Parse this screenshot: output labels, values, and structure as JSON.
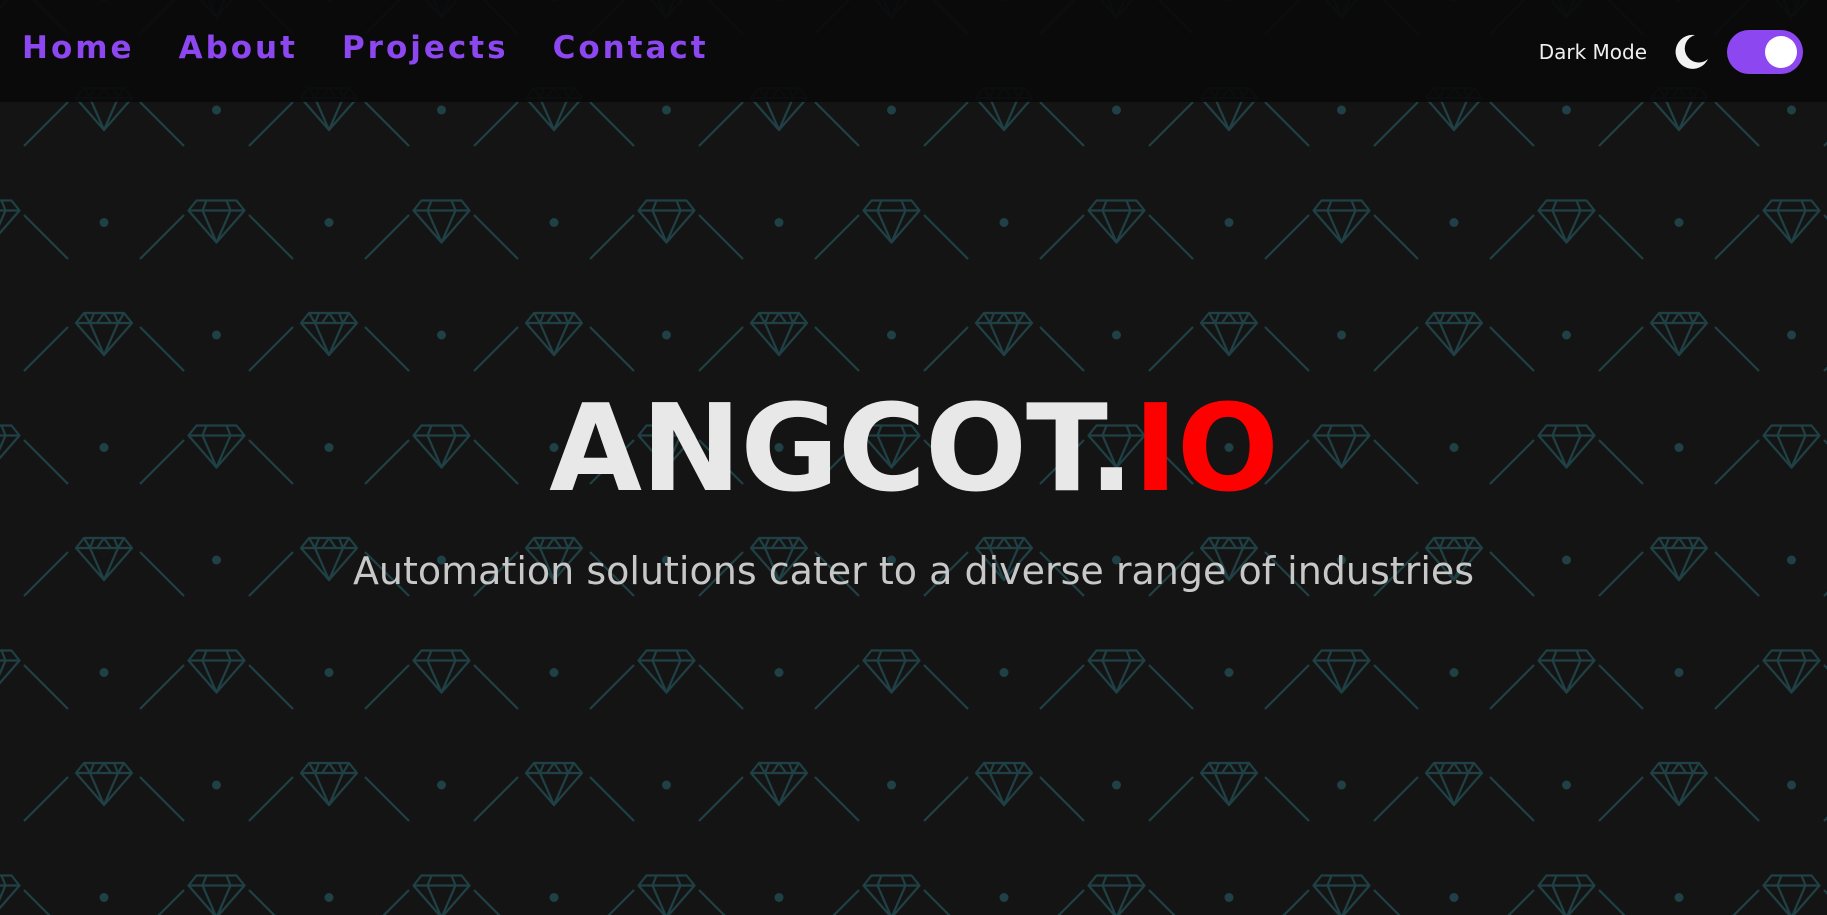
{
  "nav": {
    "items": [
      {
        "label": "Home"
      },
      {
        "label": "About"
      },
      {
        "label": "Projects"
      },
      {
        "label": "Contact"
      }
    ]
  },
  "theme": {
    "label": "Dark Mode",
    "icon": "moon-icon",
    "enabled": true
  },
  "hero": {
    "title_main": "ANGCOT.",
    "title_accent": "IO",
    "subtitle": "Automation solutions cater to a diverse range of industries"
  },
  "colors": {
    "accent": "#8d47f0",
    "brand_red": "#ff0000",
    "background": "#141414",
    "pattern": "#1f4044"
  }
}
